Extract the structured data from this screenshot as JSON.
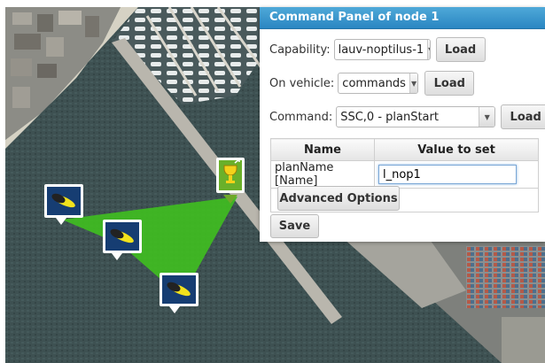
{
  "panel": {
    "title": "Command Panel of node 1",
    "capability": {
      "label": "Capability:",
      "value": "lauv-noptilus-1",
      "load_label": "Load"
    },
    "vehicle": {
      "label": "On vehicle:",
      "value": "commands",
      "load_label": "Load"
    },
    "command": {
      "label": "Command:",
      "value": "SSC,0 - planStart",
      "load_label": "Load"
    },
    "params": {
      "headers": [
        "Name",
        "Value to set"
      ],
      "rows": [
        {
          "name": "planName [Name]",
          "value": "l_nop1"
        }
      ]
    },
    "advanced_label": "Advanced Options",
    "save_label": "Save"
  },
  "map": {
    "coverage_color": "#3fbf1f",
    "vehicle_markers": [
      "auv-icon",
      "auv-icon",
      "auv-icon"
    ],
    "target_marker": "goal-marker-icon"
  }
}
